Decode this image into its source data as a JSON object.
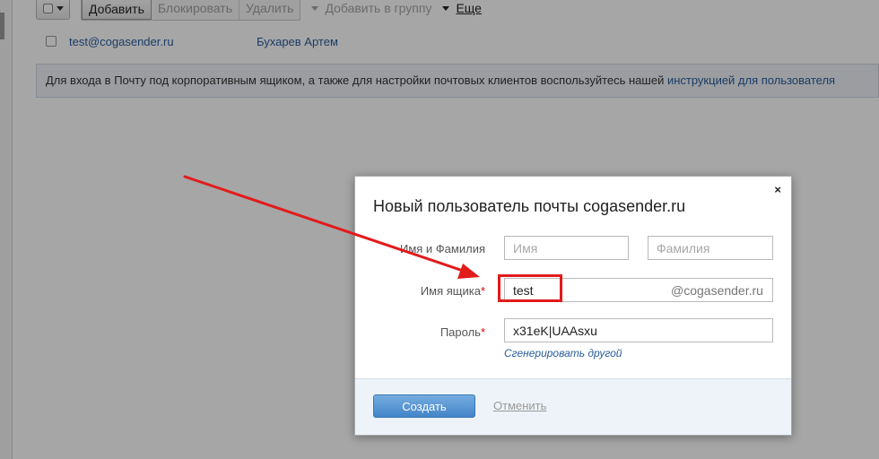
{
  "toolbar": {
    "add_label": "Добавить",
    "block_label": "Блокировать",
    "delete_label": "Удалить",
    "add_to_group_label": "Добавить в группу",
    "more_label": "Еще"
  },
  "users": [
    {
      "email": "test@cogasender.ru",
      "name": "Бухарев Артем"
    }
  ],
  "info": {
    "text": "Для входа в Почту под корпоративным ящиком, а также для настройки почтовых клиентов воспользуйтесь нашей ",
    "link_text": "инструкцией для пользователя"
  },
  "modal": {
    "title": "Новый пользователь почты cogasender.ru",
    "close_glyph": "×",
    "name_label": "Имя и Фамилия",
    "first_name_placeholder": "Имя",
    "last_name_placeholder": "Фамилия",
    "mailbox_label": "Имя ящика",
    "mailbox_value": "test",
    "domain_suffix": "@cogasender.ru",
    "password_label": "Пароль",
    "password_value": "x31eK|UAAsxu",
    "required_mark": "*",
    "generate_link": "Сгенерировать другой",
    "create_button": "Создать",
    "cancel_link": "Отменить"
  },
  "colors": {
    "link": "#2a5d9c",
    "accent_button": "#4384c8",
    "annotation": "#e21b1b",
    "footer_bg": "#edf3f8"
  }
}
